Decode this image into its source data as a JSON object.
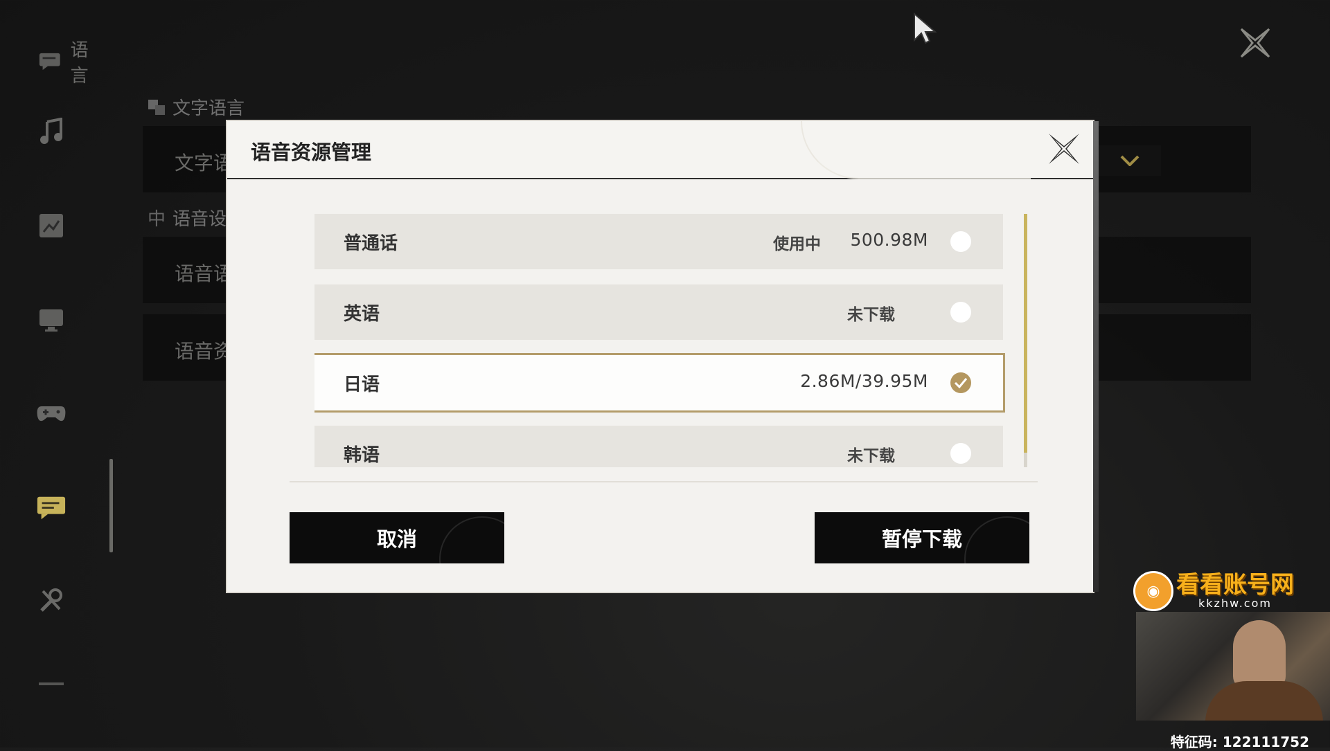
{
  "background": {
    "sidebar": {
      "active_label": "语言",
      "icons": [
        "chat-icon",
        "music-note-icon",
        "display-icon",
        "monitor-icon",
        "gamepad-icon",
        "message-icon",
        "tools-icon",
        "more-icon"
      ],
      "active_index": 5
    },
    "sections": {
      "text_language_title": "文字语言",
      "text_language_row": "文字语",
      "voice_section_title": "语音设",
      "voice_row_1": "语音语",
      "voice_row_2": "语音资"
    }
  },
  "modal": {
    "title": "语音资源管理",
    "languages": [
      {
        "name": "普通话",
        "status": "使用中",
        "size": "500.98M",
        "checked": false
      },
      {
        "name": "英语",
        "status": "未下载",
        "size": "",
        "checked": false
      },
      {
        "name": "日语",
        "status": "",
        "size": "2.86M/39.95M",
        "checked": true
      },
      {
        "name": "韩语",
        "status": "未下载",
        "size": "",
        "checked": false
      }
    ],
    "cancel_label": "取消",
    "pause_label": "暂停下载"
  },
  "overlay": {
    "watermark_title": "看看账号网",
    "watermark_url": "kkzhw.com",
    "feature_code": "特征码: 122111752"
  },
  "colors": {
    "accent": "#c9b45d",
    "selected_border": "#b39c6a",
    "button_bg": "#0c0c0c",
    "modal_bg": "#f3f2ef"
  }
}
